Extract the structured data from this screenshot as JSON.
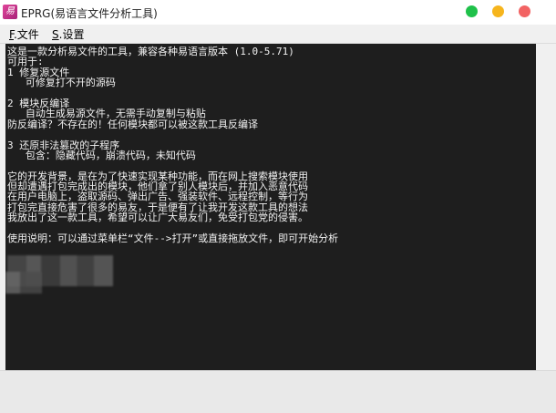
{
  "window": {
    "title": "EPRG(易语言文件分析工具)",
    "controls": {
      "minimize_color": "#1fc14a",
      "maximize_color": "#f6b51d",
      "close_color": "#f26363"
    }
  },
  "menu": {
    "file": {
      "key": "F",
      "label": ".文件"
    },
    "settings": {
      "key": "S",
      "label": ".设置"
    }
  },
  "console": {
    "lines": [
      "这是一款分析易文件的工具，兼容各种易语言版本 (1.0-5.71)",
      "可用于:",
      "1 修复源文件",
      "   可修复打不开的源码",
      "",
      "2 模块反编译",
      "   自动生成易源文件，无需手动复制与粘贴",
      "防反编译？不存在的！任何模块都可以被这款工具反编译",
      "",
      "3 还原非法篡改的子程序",
      "   包含：隐藏代码，崩溃代码，未知代码",
      "",
      "它的开发背景，是在为了快速实现某种功能，而在网上搜索模块使用",
      "但却遭遇打包完成出的模块，他们拿了别人模块后，并加入恶意代码",
      "在用户电脑上，盗取源码、弹出广告、强装软件、远程控制，等行为",
      "打包完直接危害了很多的易友，于是便有了让我开发这款工具的想法",
      "我放出了这一款工具，希望可以让广大易友们，免受打包党的侵害。",
      "",
      "使用说明：可以通过菜单栏“文件-->打开”或直接拖放文件，即可开始分析"
    ]
  }
}
